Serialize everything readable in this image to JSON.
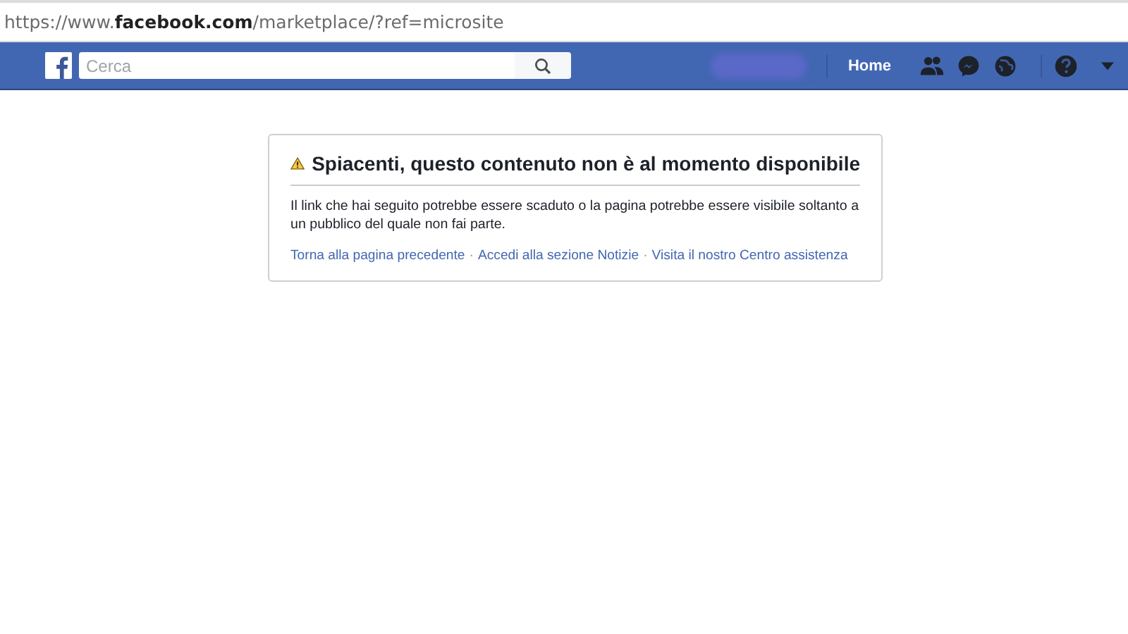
{
  "address_bar": {
    "url": "https://www.**facebook.com**/marketplace/?ref=microsite"
  },
  "top_bar": {
    "search": {
      "placeholder": "Cerca"
    },
    "nav": [
      "Home"
    ]
  },
  "notice": {
    "title": "Spiacenti, questo contenuto non è al momento disponibile",
    "message": "Il link che hai seguito potrebbe essere scaduto o la pagina potrebbe essere visibile soltanto a un pubblico del quale non fai parte.",
    "links": [
      "Torna alla pagina precedente",
      "Accedi alla sezione Notizie",
      "Visita il nostro Centro assistenza"
    ],
    "separator": "·"
  }
}
